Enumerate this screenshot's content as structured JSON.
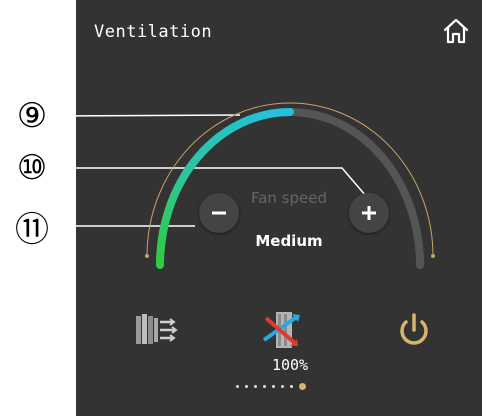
{
  "header": {
    "title": "Ventilation",
    "home_icon": "home-icon"
  },
  "gauge": {
    "label": "Fan speed",
    "mode": "Medium",
    "level": 0.5,
    "colors": {
      "green": "#2ecc40",
      "cyan": "#22c1e0",
      "track": "#555555",
      "outline": "#c8a46a"
    }
  },
  "controls": {
    "decrease_icon": "minus-icon",
    "increase_icon": "plus-icon"
  },
  "callouts": {
    "c9": "9",
    "c10": "10",
    "c11": "11"
  },
  "bottom": {
    "percent": "100%",
    "icons": [
      "ventilation-icon",
      "heat-exchange-icon",
      "power-icon"
    ],
    "power_color": "#d8b56a",
    "page_dots": 8,
    "active_dot": 7
  }
}
